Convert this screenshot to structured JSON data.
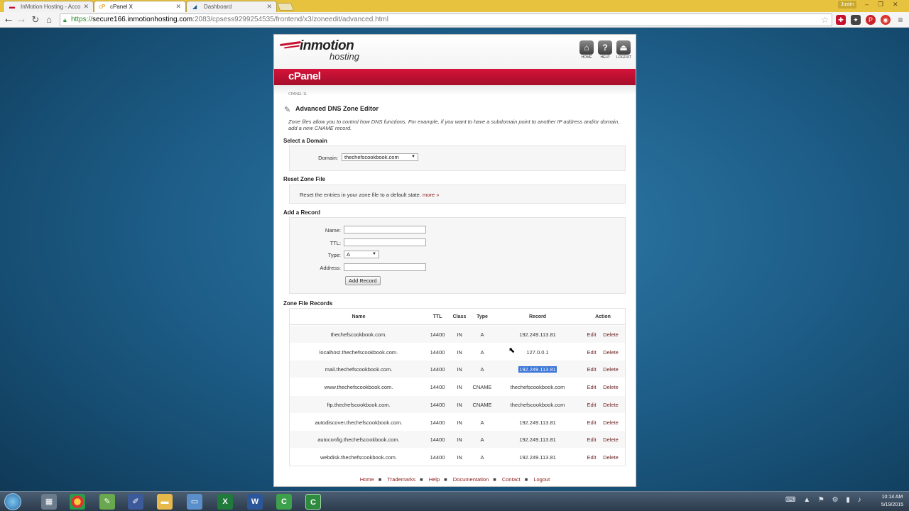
{
  "browser": {
    "tabs": [
      {
        "label": "InMotion Hosting - Acco",
        "icon": "inmotion-favicon"
      },
      {
        "label": "cPanel X",
        "icon": "cpanel-favicon"
      },
      {
        "label": "Dashboard",
        "icon": "dashboard-favicon"
      }
    ],
    "user": "Justin",
    "url": {
      "scheme": "https://",
      "host": "secure166.inmotionhosting.com",
      "path": ":2083/cpsess9299254535/frontend/x3/zoneedit/advanced.html"
    },
    "window_controls": {
      "minimize": "–",
      "restore": "❐",
      "close": "✕"
    }
  },
  "header": {
    "logo_main": "inmotion",
    "logo_sub": "hosting",
    "icons": [
      {
        "label": "HOME",
        "glyph": "⌂"
      },
      {
        "label": "HELP",
        "glyph": "?"
      },
      {
        "label": "LOGOUT",
        "glyph": "⏏"
      }
    ],
    "brand": "cPanel",
    "crumb": "CPANEL 11"
  },
  "title": "Advanced DNS Zone Editor",
  "description": "Zone files allow you to control how DNS functions. For example, if you want to have a subdomain point to another IP address and/or domain, add a new CNAME record.",
  "select_domain": {
    "heading": "Select a Domain",
    "label": "Domain:",
    "value": "thechefscookbook.com"
  },
  "reset_zone": {
    "heading": "Reset Zone File",
    "text": "Reset the entries in your zone file to a default state.",
    "more": "more »"
  },
  "add_record": {
    "heading": "Add a Record",
    "name_label": "Name:",
    "ttl_label": "TTL:",
    "type_label": "Type:",
    "type_value": "A",
    "address_label": "Address:",
    "button": "Add Record"
  },
  "zone_records": {
    "heading": "Zone File Records",
    "columns": [
      "Name",
      "TTL",
      "Class",
      "Type",
      "Record",
      "Action"
    ],
    "edit_label": "Edit",
    "delete_label": "Delete",
    "rows": [
      {
        "name": "thechefscookbook.com.",
        "ttl": "14400",
        "class": "IN",
        "type": "A",
        "record": "192.249.113.81"
      },
      {
        "name": "localhost.thechefscookbook.com.",
        "ttl": "14400",
        "class": "IN",
        "type": "A",
        "record": "127.0.0.1"
      },
      {
        "name": "mail.thechefscookbook.com.",
        "ttl": "14400",
        "class": "IN",
        "type": "A",
        "record": "192.249.113.81"
      },
      {
        "name": "www.thechefscookbook.com.",
        "ttl": "14400",
        "class": "IN",
        "type": "CNAME",
        "record": "thechefscookbook.com"
      },
      {
        "name": "ftp.thechefscookbook.com.",
        "ttl": "14400",
        "class": "IN",
        "type": "CNAME",
        "record": "thechefscookbook.com"
      },
      {
        "name": "autodiscover.thechefscookbook.com.",
        "ttl": "14400",
        "class": "IN",
        "type": "A",
        "record": "192.249.113.81"
      },
      {
        "name": "autoconfig.thechefscookbook.com.",
        "ttl": "14400",
        "class": "IN",
        "type": "A",
        "record": "192.249.113.81"
      },
      {
        "name": "webdisk.thechefscookbook.com.",
        "ttl": "14400",
        "class": "IN",
        "type": "A",
        "record": "192.249.113.81"
      }
    ]
  },
  "footer": {
    "links": [
      "Home",
      "Trademarks",
      "Help",
      "Documentation",
      "Contact",
      "Logout"
    ],
    "separator": "■"
  },
  "taskbar": {
    "time": "10:14 AM",
    "date": "5/19/2015"
  },
  "colors": {
    "accent_red": "#c8102e",
    "selection": "#3874d8",
    "tab_strip": "#e7c23f"
  }
}
